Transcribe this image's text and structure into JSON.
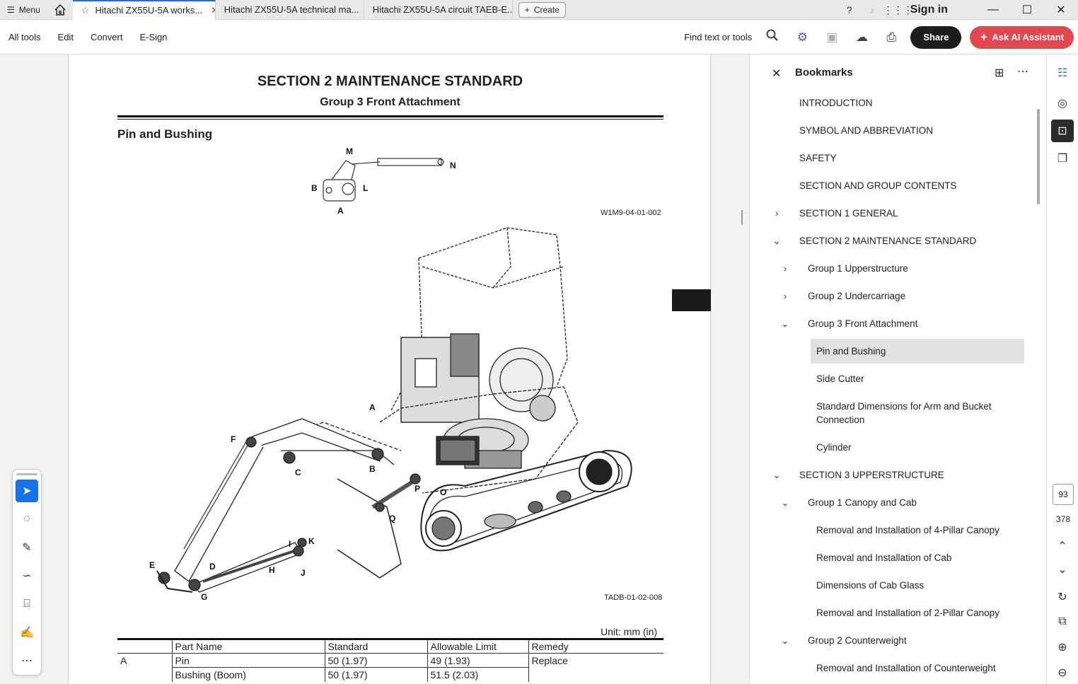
{
  "tabbar": {
    "menu_label": "Menu",
    "tabs": [
      {
        "label": "Hitachi ZX55U-5A works..."
      },
      {
        "label": "Hitachi ZX55U-5A technical ma..."
      },
      {
        "label": "Hitachi ZX55U-5A circuit TAEB-E..."
      }
    ],
    "create_label": "Create",
    "signin_label": "Sign in"
  },
  "toolbar": {
    "menu": [
      "All tools",
      "Edit",
      "Convert",
      "E-Sign"
    ],
    "find_label": "Find text or tools",
    "share_label": "Share",
    "ai_label": "Ask AI Assistant"
  },
  "page": {
    "section_title": "SECTION 2 MAINTENANCE STANDARD",
    "group_title": "Group 3 Front Attachment",
    "heading": "Pin and Bushing",
    "figure_ref_1": "W1M9-04-01-002",
    "figure_ref_2": "TADB-01-02-008",
    "unit_label": "Unit: mm (in)",
    "small_labels": [
      "M",
      "N",
      "B",
      "L",
      "A"
    ],
    "big_labels": [
      "A",
      "F",
      "C",
      "B",
      "P",
      "O",
      "Q",
      "I",
      "K",
      "E",
      "D",
      "H",
      "J",
      "G"
    ],
    "table": {
      "headers": [
        "",
        "Part Name",
        "Standard",
        "Allowable Limit",
        "Remedy"
      ],
      "rows": [
        [
          "A",
          "Pin",
          "50 (1.97)",
          "49 (1.93)",
          "Replace"
        ],
        [
          "",
          "Bushing (Boom)",
          "50 (1.97)",
          "51.5 (2.03)",
          ""
        ]
      ]
    }
  },
  "bookmarks": {
    "title": "Bookmarks",
    "items": [
      {
        "label": "INTRODUCTION",
        "level": 0,
        "chevron": ""
      },
      {
        "label": "SYMBOL AND ABBREVIATION",
        "level": 0,
        "chevron": ""
      },
      {
        "label": "SAFETY",
        "level": 0,
        "chevron": ""
      },
      {
        "label": "SECTION AND GROUP CONTENTS",
        "level": 0,
        "chevron": ""
      },
      {
        "label": "SECTION 1 GENERAL",
        "level": 0,
        "chevron": "›"
      },
      {
        "label": "SECTION 2 MAINTENANCE STANDARD",
        "level": 0,
        "chevron": "⌄"
      },
      {
        "label": "Group 1 Upperstructure",
        "level": 1,
        "chevron": "›"
      },
      {
        "label": "Group 2 Undercarriage",
        "level": 1,
        "chevron": "›"
      },
      {
        "label": "Group 3 Front Attachment",
        "level": 1,
        "chevron": "⌄"
      },
      {
        "label": "Pin and Bushing",
        "level": 2,
        "chevron": "",
        "selected": true
      },
      {
        "label": "Side Cutter",
        "level": 2,
        "chevron": ""
      },
      {
        "label": "Standard Dimensions for Arm and Bucket Connection",
        "level": 2,
        "chevron": "",
        "tall": true
      },
      {
        "label": "Cylinder",
        "level": 2,
        "chevron": ""
      },
      {
        "label": "SECTION 3 UPPERSTRUCTURE",
        "level": 0,
        "chevron": "⌄"
      },
      {
        "label": "Group 1 Canopy and Cab",
        "level": 1,
        "chevron": "⌄"
      },
      {
        "label": "Removal and Installation of 4-Pillar Canopy",
        "level": 2,
        "chevron": ""
      },
      {
        "label": "Removal and Installation of Cab",
        "level": 2,
        "chevron": ""
      },
      {
        "label": "Dimensions of Cab Glass",
        "level": 2,
        "chevron": ""
      },
      {
        "label": "Removal and Installation of 2-Pillar Canopy",
        "level": 2,
        "chevron": ""
      },
      {
        "label": "Group 2 Counterweight",
        "level": 1,
        "chevron": "⌄"
      },
      {
        "label": "Removal and Installation of Counterweight",
        "level": 2,
        "chevron": ""
      }
    ]
  },
  "rail": {
    "current_page": "93",
    "total_pages": "378"
  },
  "colors": {
    "accent": "#1473e6",
    "ai_button": "#e34850",
    "share_button": "#1d1d1d"
  }
}
